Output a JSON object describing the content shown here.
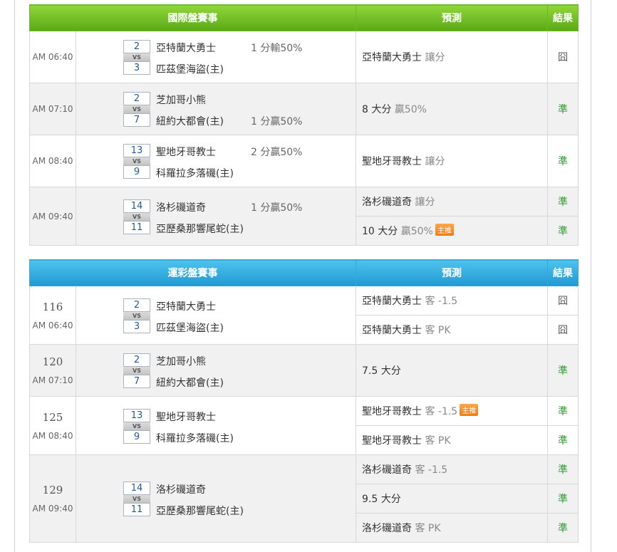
{
  "international": {
    "headers": {
      "match": "國際盤賽事",
      "prediction": "預測",
      "result": "結果"
    },
    "games": [
      {
        "time": "AM 06:40",
        "away_score": "2",
        "home_score": "3",
        "away": "亞特蘭大勇士",
        "home": "匹茲堡海盜(主)",
        "line": "1 分輸50%",
        "line_row": "away",
        "predictions": [
          {
            "pick": "亞特蘭大勇士",
            "note": "讓分",
            "tag": "",
            "result": "囧"
          }
        ]
      },
      {
        "time": "AM 07:10",
        "away_score": "2",
        "home_score": "7",
        "away": "芝加哥小熊",
        "home": "紐約大都會(主)",
        "line": "1 分贏50%",
        "line_row": "home",
        "predictions": [
          {
            "pick": "8 大分",
            "note": "贏50%",
            "tag": "",
            "result": "準"
          }
        ]
      },
      {
        "time": "AM 08:40",
        "away_score": "13",
        "home_score": "9",
        "away": "聖地牙哥教士",
        "home": "科羅拉多落磯(主)",
        "line": "2 分贏50%",
        "line_row": "away",
        "predictions": [
          {
            "pick": "聖地牙哥教士",
            "note": "讓分",
            "tag": "",
            "result": "準"
          }
        ]
      },
      {
        "time": "AM 09:40",
        "away_score": "14",
        "home_score": "11",
        "away": "洛杉磯道奇",
        "home": "亞歷桑那響尾蛇(主)",
        "line": "1 分贏50%",
        "line_row": "away",
        "predictions": [
          {
            "pick": "洛杉磯道奇",
            "note": "讓分",
            "tag": "",
            "result": "準"
          },
          {
            "pick": "10 大分",
            "note": "贏50%",
            "tag": "主推",
            "result": "準"
          }
        ]
      }
    ]
  },
  "sports_lottery": {
    "headers": {
      "match": "運彩盤賽事",
      "prediction": "預測",
      "result": "結果"
    },
    "games": [
      {
        "number": "116",
        "time": "AM 06:40",
        "away_score": "2",
        "home_score": "3",
        "away": "亞特蘭大勇士",
        "home": "匹茲堡海盜(主)",
        "predictions": [
          {
            "pick": "亞特蘭大勇士",
            "note": "客 -1.5",
            "tag": "",
            "result": "囧"
          },
          {
            "pick": "亞特蘭大勇士",
            "note": "客 PK",
            "tag": "",
            "result": "囧"
          }
        ]
      },
      {
        "number": "120",
        "time": "AM 07:10",
        "away_score": "2",
        "home_score": "7",
        "away": "芝加哥小熊",
        "home": "紐約大都會(主)",
        "predictions": [
          {
            "pick": "7.5 大分",
            "note": "",
            "tag": "",
            "result": "準"
          }
        ]
      },
      {
        "number": "125",
        "time": "AM 08:40",
        "away_score": "13",
        "home_score": "9",
        "away": "聖地牙哥教士",
        "home": "科羅拉多落磯(主)",
        "predictions": [
          {
            "pick": "聖地牙哥教士",
            "note": "客 -1.5",
            "tag": "主推",
            "result": "準"
          },
          {
            "pick": "聖地牙哥教士",
            "note": "客 PK",
            "tag": "",
            "result": "準"
          }
        ]
      },
      {
        "number": "129",
        "time": "AM 09:40",
        "away_score": "14",
        "home_score": "11",
        "away": "洛杉磯道奇",
        "home": "亞歷桑那響尾蛇(主)",
        "predictions": [
          {
            "pick": "洛杉磯道奇",
            "note": "客 -1.5",
            "tag": "",
            "result": "準"
          },
          {
            "pick": "9.5 大分",
            "note": "",
            "tag": "",
            "result": "準"
          },
          {
            "pick": "洛杉磯道奇",
            "note": "客 PK",
            "tag": "",
            "result": "準"
          }
        ]
      }
    ]
  },
  "colors": {
    "green_header": "#6bbd1f",
    "blue_header": "#2aa7de",
    "win": "#2e9b2e",
    "accent_tag": "#f28a1e"
  }
}
